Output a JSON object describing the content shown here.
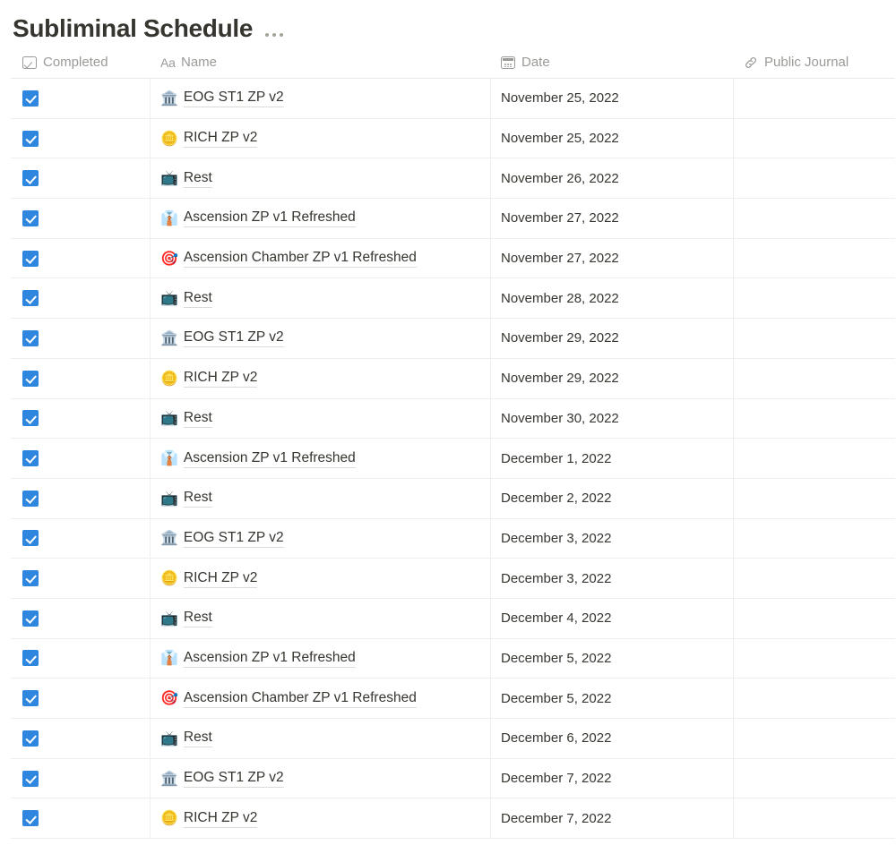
{
  "page": {
    "title": "Subliminal Schedule",
    "menu_icon": "ellipsis-icon"
  },
  "table": {
    "columns": [
      {
        "key": "completed",
        "label": "Completed",
        "icon": "checkbox-icon",
        "type": "checkbox"
      },
      {
        "key": "name",
        "label": "Name",
        "icon": "text-aa-icon",
        "type": "title"
      },
      {
        "key": "date",
        "label": "Date",
        "icon": "calendar-icon",
        "type": "date"
      },
      {
        "key": "journal",
        "label": "Public Journal",
        "icon": "link-icon",
        "type": "url"
      }
    ],
    "accent_color": "#2e86de",
    "rows": [
      {
        "completed": true,
        "emoji": "🏛️",
        "name": "EOG ST1 ZP v2",
        "date": "November 25, 2022",
        "journal": ""
      },
      {
        "completed": true,
        "emoji": "🪙",
        "name": "RICH ZP v2",
        "date": "November 25, 2022",
        "journal": ""
      },
      {
        "completed": true,
        "emoji": "📺",
        "name": "Rest",
        "date": "November 26, 2022",
        "journal": ""
      },
      {
        "completed": true,
        "emoji": "👔",
        "name": "Ascension ZP v1 Refreshed",
        "date": "November 27, 2022",
        "journal": ""
      },
      {
        "completed": true,
        "emoji": "🎯",
        "name": "Ascension Chamber ZP v1 Refreshed",
        "date": "November 27, 2022",
        "journal": ""
      },
      {
        "completed": true,
        "emoji": "📺",
        "name": "Rest",
        "date": "November 28, 2022",
        "journal": ""
      },
      {
        "completed": true,
        "emoji": "🏛️",
        "name": "EOG ST1 ZP v2",
        "date": "November 29, 2022",
        "journal": ""
      },
      {
        "completed": true,
        "emoji": "🪙",
        "name": "RICH ZP v2",
        "date": "November 29, 2022",
        "journal": ""
      },
      {
        "completed": true,
        "emoji": "📺",
        "name": "Rest",
        "date": "November 30, 2022",
        "journal": ""
      },
      {
        "completed": true,
        "emoji": "👔",
        "name": "Ascension ZP v1 Refreshed",
        "date": "December 1, 2022",
        "journal": ""
      },
      {
        "completed": true,
        "emoji": "📺",
        "name": "Rest",
        "date": "December 2, 2022",
        "journal": ""
      },
      {
        "completed": true,
        "emoji": "🏛️",
        "name": "EOG ST1 ZP v2",
        "date": "December 3, 2022",
        "journal": ""
      },
      {
        "completed": true,
        "emoji": "🪙",
        "name": "RICH ZP v2",
        "date": "December 3, 2022",
        "journal": ""
      },
      {
        "completed": true,
        "emoji": "📺",
        "name": "Rest",
        "date": "December 4, 2022",
        "journal": ""
      },
      {
        "completed": true,
        "emoji": "👔",
        "name": "Ascension ZP v1 Refreshed",
        "date": "December 5, 2022",
        "journal": ""
      },
      {
        "completed": true,
        "emoji": "🎯",
        "name": "Ascension Chamber ZP v1 Refreshed",
        "date": "December 5, 2022",
        "journal": ""
      },
      {
        "completed": true,
        "emoji": "📺",
        "name": "Rest",
        "date": "December 6, 2022",
        "journal": ""
      },
      {
        "completed": true,
        "emoji": "🏛️",
        "name": "EOG ST1 ZP v2",
        "date": "December 7, 2022",
        "journal": ""
      },
      {
        "completed": true,
        "emoji": "🪙",
        "name": "RICH ZP v2",
        "date": "December 7, 2022",
        "journal": ""
      }
    ]
  }
}
